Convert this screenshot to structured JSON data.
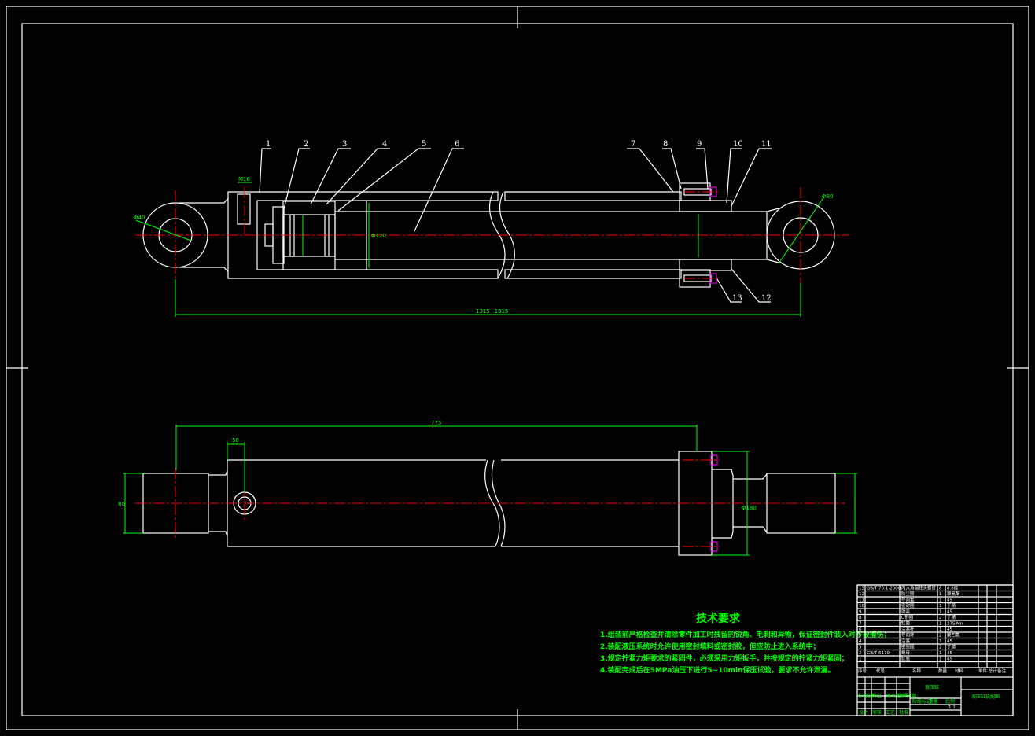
{
  "drawing": {
    "colors": {
      "background": "#000000",
      "outline": "#ffffff",
      "dimension": "#00ff00",
      "centerline": "#ff0000",
      "hatch": "#00ffff",
      "bolt": "#ff00ff"
    },
    "part_labels": [
      "1",
      "2",
      "3",
      "4",
      "5",
      "6",
      "7",
      "8",
      "9",
      "10",
      "11",
      "12",
      "13"
    ],
    "dimensions": {
      "top_overall": "1315~1815",
      "bottom_length": "775",
      "bottom_offset": "50",
      "left_eye": "Φ40",
      "right_eye": "Φ80",
      "port": "M16",
      "bore": "Φ120",
      "flange": "Φ180",
      "end_width": "80"
    }
  },
  "tech_requirements": {
    "title": "技术要求",
    "items": [
      "1.组装前严格检查并清除零件加工时残留的锐角、毛刺和异物，保证密封件装入时不被擦伤；",
      "2.装配液压系统时允许使用密封填料或密封胶，但应防止进入系统中；",
      "3.规定拧紧力矩要求的紧固件，必须采用力矩扳手，并按规定的拧紧力矩紧固；",
      "4.装配完成后在5MPa油压下进行5~10min保压试验，要求不允许泄漏。"
    ]
  },
  "title_block": {
    "bom_rows": [
      {
        "no": "13",
        "code": "GB/T 70.1-2000",
        "name": "内六角圆柱头螺钉",
        "qty": "8",
        "mat": "8.8级"
      },
      {
        "no": "12",
        "code": "",
        "name": "防尘圈",
        "qty": "1",
        "mat": "聚氨酯"
      },
      {
        "no": "11",
        "code": "",
        "name": "导向套",
        "qty": "1",
        "mat": "45"
      },
      {
        "no": "10",
        "code": "",
        "name": "密封圈",
        "qty": "1",
        "mat": "丁腈"
      },
      {
        "no": "9",
        "code": "",
        "name": "端盖",
        "qty": "1",
        "mat": "45"
      },
      {
        "no": "8",
        "code": "",
        "name": "O形圈",
        "qty": "2",
        "mat": "丁腈"
      },
      {
        "no": "7",
        "code": "",
        "name": "缸筒",
        "qty": "1",
        "mat": "27SiMn"
      },
      {
        "no": "6",
        "code": "",
        "name": "活塞杆",
        "qty": "1",
        "mat": "45"
      },
      {
        "no": "5",
        "code": "",
        "name": "导向环",
        "qty": "2",
        "mat": "聚四氟"
      },
      {
        "no": "4",
        "code": "",
        "name": "活塞",
        "qty": "1",
        "mat": "45"
      },
      {
        "no": "3",
        "code": "",
        "name": "密封圈",
        "qty": "2",
        "mat": "丁腈"
      },
      {
        "no": "2",
        "code": "GB/T 6170",
        "name": "螺母",
        "qty": "1",
        "mat": "45"
      },
      {
        "no": "1",
        "code": "",
        "name": "缸底",
        "qty": "1",
        "mat": "45"
      }
    ],
    "headers": {
      "no": "序号",
      "code": "代号",
      "name": "名称",
      "qty": "数量",
      "mat": "材料",
      "weight": "单件 总计",
      "weight2": "重量",
      "remark": "备注"
    },
    "drawing_name": "液压缸",
    "school": "液压缸装配图",
    "sign_row": [
      "标记",
      "处数",
      "分区",
      "更改文件号",
      "签名",
      "日期"
    ],
    "stage_row": [
      "阶段标记",
      "重量",
      "比例"
    ],
    "scale": "1:1",
    "bottom_row": [
      "设计",
      "审核",
      "工艺",
      "批准"
    ]
  }
}
